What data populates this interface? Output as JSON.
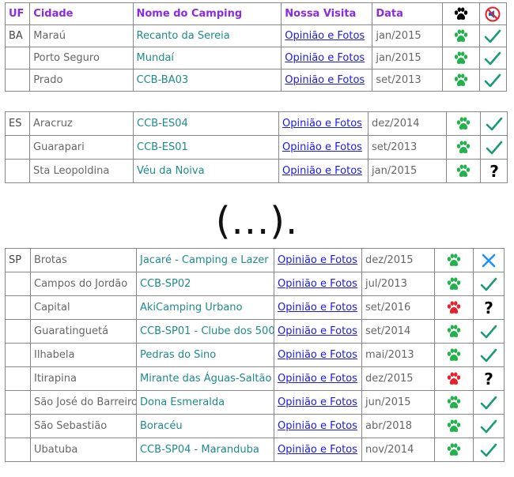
{
  "header": {
    "uf": "UF",
    "cidade": "Cidade",
    "nome": "Nome do Camping",
    "visita": "Nossa Visita",
    "data": "Data"
  },
  "sections": [
    {
      "uf": "BA",
      "rows": [
        {
          "cidade": "Maraú",
          "camping": "Recanto da Sereia",
          "link": "Opinião e Fotos",
          "data": "jan/2015",
          "paw": "green",
          "status": "check"
        },
        {
          "cidade": "Porto Seguro",
          "camping": "Mundaí",
          "link": "Opinião e Fotos",
          "data": "jan/2015",
          "paw": "green",
          "status": "check"
        },
        {
          "cidade": "Prado",
          "camping": "CCB-BA03",
          "link": "Opinião e Fotos",
          "data": "set/2013",
          "paw": "green",
          "status": "check"
        }
      ]
    },
    {
      "uf": "ES",
      "rows": [
        {
          "cidade": "Aracruz",
          "camping": "CCB-ES04",
          "link": "Opinião e Fotos",
          "data": "dez/2014",
          "paw": "green",
          "status": "check"
        },
        {
          "cidade": "Guarapari",
          "camping": "CCB-ES01",
          "link": "Opinião e Fotos",
          "data": "set/2013",
          "paw": "green",
          "status": "check"
        },
        {
          "cidade": "Sta Leopoldina",
          "camping": "Véu da Noiva",
          "link": "Opinião e Fotos",
          "data": "jan/2015",
          "paw": "green",
          "status": "question"
        }
      ]
    },
    {
      "uf": "SP",
      "rows": [
        {
          "cidade": "Brotas",
          "camping": "Jacaré - Camping e Lazer",
          "link": "Opinião e Fotos",
          "data": "dez/2015",
          "paw": "green",
          "status": "cross"
        },
        {
          "cidade": "Campos do Jordão",
          "camping": "CCB-SP02",
          "link": "Opinião e Fotos",
          "data": "jul/2013",
          "paw": "green",
          "status": "check"
        },
        {
          "cidade": "Capital",
          "camping": "AkiCamping Urbano",
          "link": "Opinião e Fotos",
          "data": "set/2016",
          "paw": "red",
          "status": "question"
        },
        {
          "cidade": "Guaratinguetá",
          "camping": "CCB-SP01 - Clube dos 500",
          "link": "Opinião e Fotos",
          "data": "set/2014",
          "paw": "green",
          "status": "check"
        },
        {
          "cidade": "Ilhabela",
          "camping": "Pedras do Sino",
          "link": "Opinião e Fotos",
          "data": "mai/2013",
          "paw": "green",
          "status": "check"
        },
        {
          "cidade": "Itirapina",
          "camping": "Mirante das Águas-Saltão",
          "link": "Opinião e Fotos",
          "data": "dez/2015",
          "paw": "red",
          "status": "question"
        },
        {
          "cidade": "São José do Barreiro",
          "camping": "Dona Esmeralda",
          "link": "Opinião e Fotos",
          "data": "jun/2015",
          "paw": "green",
          "status": "check"
        },
        {
          "cidade": "São Sebastião",
          "camping": "Boracéu",
          "link": "Opinião e Fotos",
          "data": "abr/2018",
          "paw": "green",
          "status": "check"
        },
        {
          "cidade": "Ubatuba",
          "camping": "CCB-SP04 - Maranduba",
          "link": "Opinião e Fotos",
          "data": "nov/2014",
          "paw": "green",
          "status": "check"
        }
      ]
    }
  ],
  "ellipsis": "(...).",
  "colors": {
    "paw_green": "#22b14c",
    "paw_red": "#e8202a",
    "check": "#1a9a7a",
    "cross": "#1e90ff",
    "header_text": "#8a2be2",
    "camping_text": "#1f8a8a",
    "link": "#1a1ae6"
  },
  "icons": {
    "header_paw": "paw-icon",
    "header_no_sound": "no-sound-icon"
  }
}
